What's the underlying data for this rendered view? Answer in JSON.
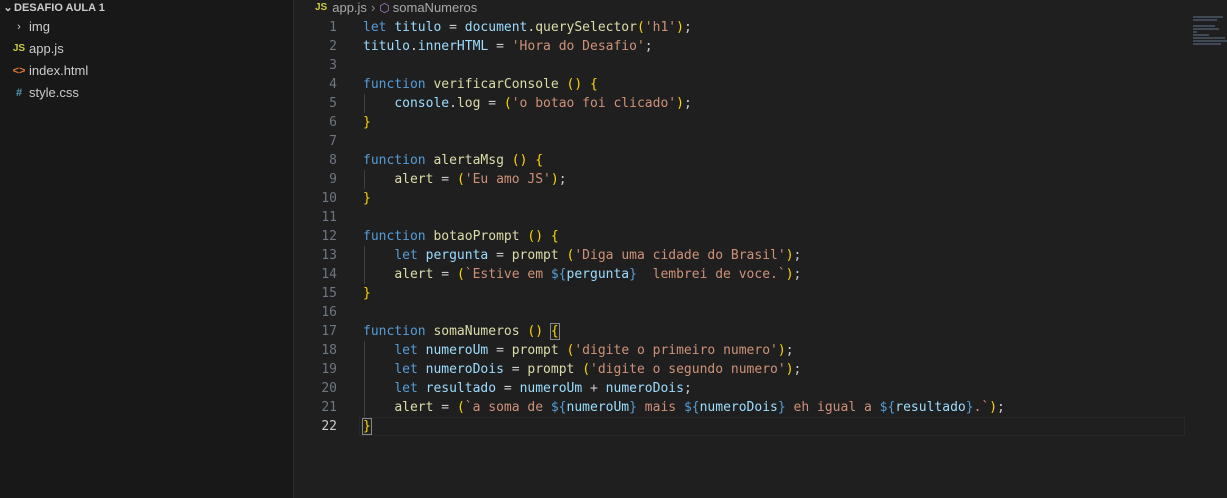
{
  "explorer": {
    "folder_chevron": "⌄",
    "folder_title": "DESAFIO AULA 1",
    "items": [
      {
        "icon": "›",
        "label": "img"
      },
      {
        "icon": "JS",
        "label": "app.js"
      },
      {
        "icon": "<>",
        "label": "index.html"
      },
      {
        "icon": "#",
        "label": "style.css"
      }
    ]
  },
  "breadcrumb": {
    "file_icon": "JS",
    "file": "app.js",
    "separator": "›",
    "symbol_icon": "⬡",
    "symbol": "somaNumeros"
  },
  "editor": {
    "active_line": "22",
    "line_numbers": [
      "1",
      "2",
      "3",
      "4",
      "5",
      "6",
      "7",
      "8",
      "9",
      "10",
      "11",
      "12",
      "13",
      "14",
      "15",
      "16",
      "17",
      "18",
      "19",
      "20",
      "21",
      "22"
    ],
    "lines": [
      "let titulo = document.querySelector('h1');",
      "titulo.innerHTML = 'Hora do Desafio';",
      "",
      "function verificarConsole () {",
      "    console.log = ('o botao foi clicado');",
      "}",
      "",
      "function alertaMsg () {",
      "    alert = ('Eu amo JS');",
      "}",
      "",
      "function botaoPrompt () {",
      "    let pergunta = prompt ('Diga uma cidade do Brasil');",
      "    alert = (`Estive em ${pergunta}  lembrei de voce.`);",
      "}",
      "",
      "function somaNumeros () {",
      "    let numeroUm = prompt ('digite o primeiro numero');",
      "    let numeroDois = prompt ('digite o segundo numero');",
      "    let resultado = numeroUm + numeroDois;",
      "    alert = (`a soma de ${numeroUm} mais ${numeroDois} eh igual a ${resultado}.`);",
      "}"
    ]
  },
  "colors": {
    "keyword": "#569cd6",
    "function": "#dcdcaa",
    "variable": "#9cdcfe",
    "string": "#ce9178",
    "bracket_level1": "#ffd700",
    "bracket_level2": "#da70d6",
    "bracket_level3": "#179fff"
  }
}
